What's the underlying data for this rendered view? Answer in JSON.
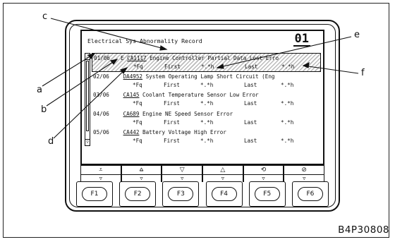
{
  "screen": {
    "title": "Electrical Sys Abnormality Record",
    "page_number": "01",
    "rows": [
      {
        "date": "01/06",
        "flag": "E",
        "code": "CA1117",
        "message": "Engine Controller Partial Data Lost Erro",
        "fq": "*Fq",
        "first": "First",
        "first_val": "*.*h",
        "last": "Last",
        "last_val": "*.*h"
      },
      {
        "date": "02/06",
        "flag": "",
        "code": "DA4952",
        "message": "System Operating Lamp Short Circuit (Eng",
        "fq": "*Fq",
        "first": "First",
        "first_val": "*.*h",
        "last": "Last",
        "last_val": "*.*h"
      },
      {
        "date": "03/06",
        "flag": "",
        "code": "CA145",
        "message": "Coolant Temperature Sensor Low Error",
        "fq": "*Fq",
        "first": "First",
        "first_val": "*.*h",
        "last": "Last",
        "last_val": "*.*h"
      },
      {
        "date": "04/06",
        "flag": "",
        "code": "CA689",
        "message": "Engine NE Speed Sensor Error",
        "fq": "*Fq",
        "first": "First",
        "first_val": "*.*h",
        "last": "Last",
        "last_val": "*.*h"
      },
      {
        "date": "05/06",
        "flag": "",
        "code": "CA442",
        "message": "Battery Voltage High Error",
        "fq": "*Fq",
        "first": "First",
        "first_val": "*.*h",
        "last": "Last",
        "last_val": "*.*h"
      }
    ],
    "softkeys": [
      "⩡",
      "⩠",
      "▽",
      "△",
      "⟲",
      "⊘"
    ],
    "indicator_arrows": [
      "▽",
      "▽",
      "▽",
      "▽",
      "▽",
      "▽"
    ],
    "scroll_up": "△",
    "scroll_down": "▽"
  },
  "function_keys": [
    "F1",
    "F2",
    "F3",
    "F4",
    "F5",
    "F6"
  ],
  "callouts": {
    "a": "a",
    "b": "b",
    "c": "c",
    "d": "d",
    "e": "e",
    "f": "f"
  },
  "figure_id": "B4P30808"
}
